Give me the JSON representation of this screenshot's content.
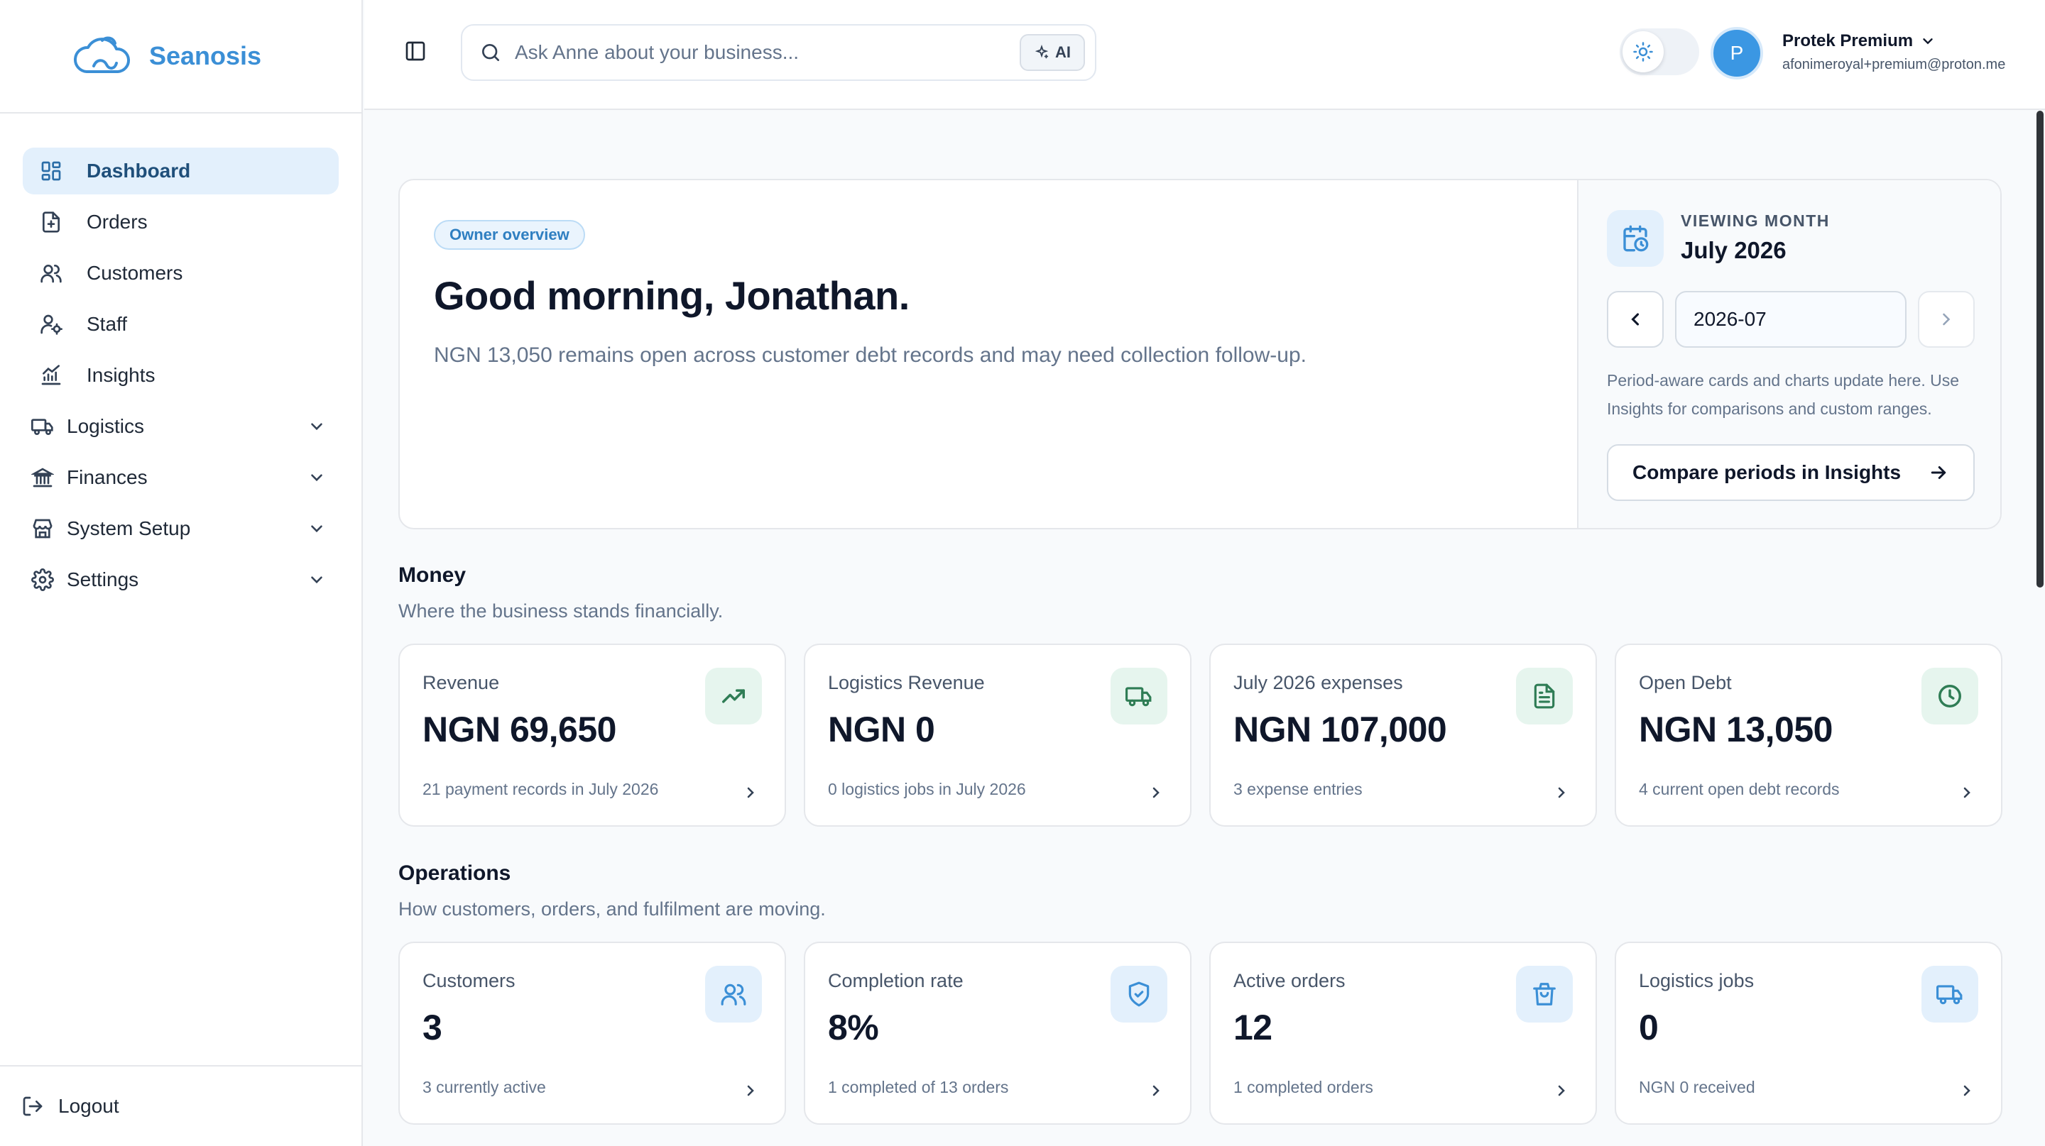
{
  "brand": {
    "name": "Seanosis"
  },
  "sidebar": {
    "items": [
      {
        "label": "Dashboard",
        "icon": "dashboard-icon",
        "active": true
      },
      {
        "label": "Orders",
        "icon": "orders-icon"
      },
      {
        "label": "Customers",
        "icon": "customers-icon"
      },
      {
        "label": "Staff",
        "icon": "staff-icon"
      },
      {
        "label": "Insights",
        "icon": "insights-icon"
      },
      {
        "label": "Logistics",
        "icon": "truck-icon",
        "expandable": true
      },
      {
        "label": "Finances",
        "icon": "bank-icon",
        "expandable": true
      },
      {
        "label": "System Setup",
        "icon": "store-icon",
        "expandable": true
      },
      {
        "label": "Settings",
        "icon": "gear-icon",
        "expandable": true
      }
    ],
    "logout_label": "Logout"
  },
  "header": {
    "search_placeholder": "Ask Anne about your business...",
    "ai_label": "AI",
    "user": {
      "initial": "P",
      "name": "Protek Premium",
      "email": "afonimeroyal+premium@proton.me"
    }
  },
  "hero": {
    "badge": "Owner overview",
    "greeting": "Good morning, Jonathan.",
    "message": "NGN 13,050 remains open across customer debt records and may need collection follow-up.",
    "viewing_label": "VIEWING MONTH",
    "viewing_month": "July 2026",
    "month_value": "2026-07",
    "note": "Period-aware cards and charts update here. Use Insights for comparisons and custom ranges.",
    "compare_label": "Compare periods in Insights"
  },
  "money": {
    "title": "Money",
    "subtitle": "Where the business stands financially.",
    "cards": [
      {
        "label": "Revenue",
        "value": "NGN 69,650",
        "foot": "21 payment records in July 2026",
        "icon": "trending-up-icon"
      },
      {
        "label": "Logistics Revenue",
        "value": "NGN 0",
        "foot": "0 logistics jobs in July 2026",
        "icon": "truck-icon"
      },
      {
        "label": "July 2026 expenses",
        "value": "NGN 107,000",
        "foot": "3 expense entries",
        "icon": "document-icon"
      },
      {
        "label": "Open Debt",
        "value": "NGN 13,050",
        "foot": "4 current open debt records",
        "icon": "clock-icon"
      }
    ]
  },
  "operations": {
    "title": "Operations",
    "subtitle": "How customers, orders, and fulfilment are moving.",
    "cards": [
      {
        "label": "Customers",
        "value": "3",
        "foot": "3 currently active",
        "icon": "users-icon"
      },
      {
        "label": "Completion rate",
        "value": "8%",
        "foot": "1 completed of 13 orders",
        "icon": "shield-check-icon"
      },
      {
        "label": "Active orders",
        "value": "12",
        "foot": "1 completed orders",
        "icon": "shopping-bag-icon"
      },
      {
        "label": "Logistics jobs",
        "value": "0",
        "foot": "NGN 0 received",
        "icon": "truck-icon"
      }
    ]
  },
  "colors": {
    "accent": "#3b8fd6",
    "active_bg": "#e3f0fc",
    "money_icon": "#2f7d55",
    "ops_icon": "#3b8fd6"
  }
}
